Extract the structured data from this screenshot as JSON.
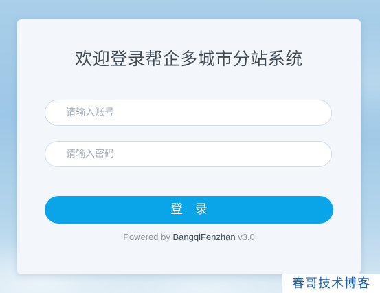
{
  "login": {
    "title": "欢迎登录帮企多城市分站系统",
    "account_placeholder": "请输入账号",
    "password_placeholder": "请输入密码",
    "submit_label": "登 录",
    "powered_prefix": "Powered by",
    "powered_brand": "BangqiFenzhan",
    "version": "v3.0"
  },
  "watermark": {
    "text": "春哥技术博客"
  },
  "colors": {
    "primary": "#09a5e8",
    "card_background": "#f3f7fb",
    "watermark_text": "#1f5fa8"
  }
}
